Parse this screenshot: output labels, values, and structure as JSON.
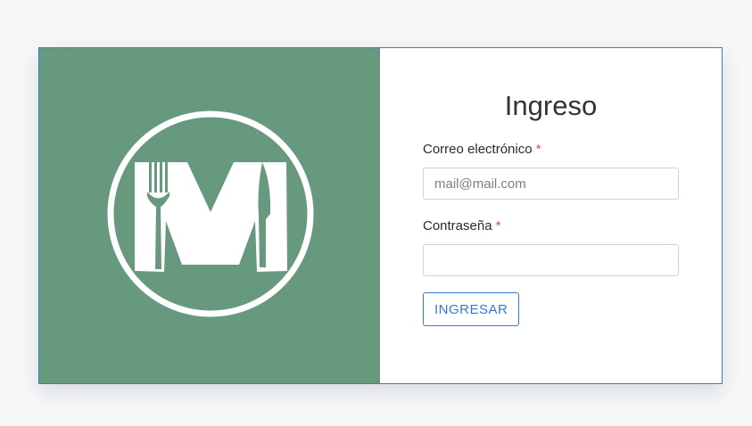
{
  "brand": {
    "logo_icon": "fork-knife-m-logo-icon",
    "panel_color": "#66997e"
  },
  "form": {
    "title": "Ingreso",
    "email": {
      "label": "Correo electrónico",
      "required_mark": "*",
      "placeholder": "mail@mail.com",
      "value": ""
    },
    "password": {
      "label": "Contraseña",
      "required_mark": "*",
      "placeholder": "",
      "value": ""
    },
    "submit_label": "INGRESAR",
    "accent_color": "#2f7bd6"
  }
}
